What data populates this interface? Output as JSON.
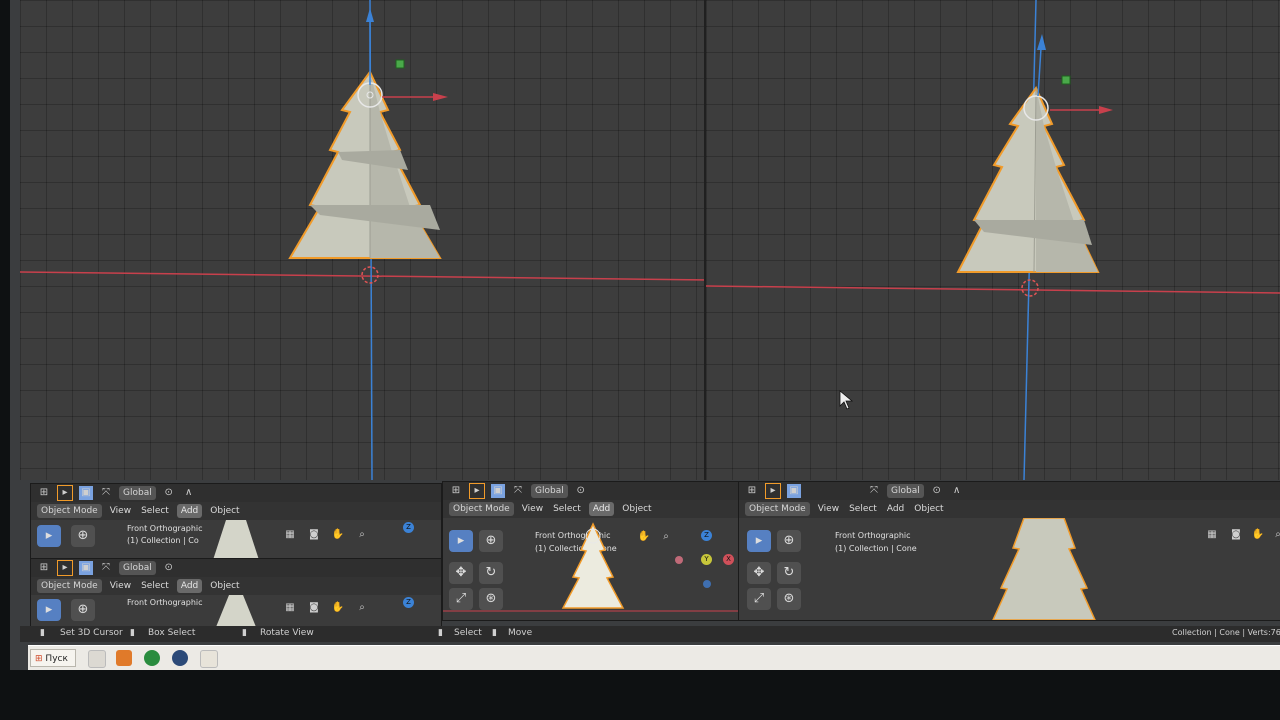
{
  "header": {
    "transform_orientation": "Global",
    "mode": "Object Mode",
    "menus": [
      "View",
      "Select",
      "Add",
      "Object"
    ]
  },
  "viewport": {
    "view_name": "Front Orthographic",
    "collection": "(1) Collection | Cone",
    "collection_cut": "(1) Collection | Co",
    "gizmo_axes": [
      "Z",
      "Y",
      "X"
    ]
  },
  "status": {
    "set_cursor": "Set 3D Cursor",
    "box_select": "Box Select",
    "rotate_view": "Rotate View",
    "select": "Select",
    "move": "Move",
    "info": "Collection | Cone | Verts:76 |"
  },
  "taskbar": {
    "start": "Пуск"
  },
  "colors": {
    "grid_bg": "#3d3d3d",
    "axis_x": "#c8404c",
    "axis_z": "#3b82d6",
    "selection_outline": "#f19b2a",
    "tool_active": "#5680c2"
  },
  "icons": [
    "editor-type-icon",
    "select-box-icon",
    "pivot-icon",
    "snap-icon",
    "proportional-icon",
    "cursor-icon",
    "move-icon",
    "rotate-icon",
    "scale-icon",
    "transform-icon",
    "grid-icon",
    "camera-icon",
    "hand-icon",
    "zoom-icon",
    "windows-start-icon"
  ]
}
